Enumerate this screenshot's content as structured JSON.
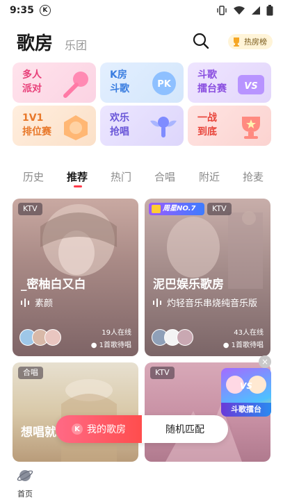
{
  "status_bar": {
    "time": "9:35",
    "badge": "K"
  },
  "header": {
    "title": "歌房",
    "subtitle": "乐团",
    "hot_label": "热房榜"
  },
  "categories": [
    {
      "label": "多人\n派对"
    },
    {
      "label": "K房\n斗歌"
    },
    {
      "label": "斗歌\n擂台赛"
    },
    {
      "label": "1V1\n排位赛"
    },
    {
      "label": "欢乐\n抢唱"
    },
    {
      "label": "一战\n到底"
    }
  ],
  "category_art_text": {
    "pk": "PK",
    "vs": "VS"
  },
  "tabs": [
    {
      "label": "历史"
    },
    {
      "label": "推荐"
    },
    {
      "label": "热门"
    },
    {
      "label": "合唱"
    },
    {
      "label": "附近"
    },
    {
      "label": "抢麦"
    }
  ],
  "rooms": [
    {
      "tag": "KTV",
      "name": "_密柚白又白",
      "song": "素颜",
      "online": "19人在线",
      "waiting": "1首歌待唱"
    },
    {
      "tag": "KTV",
      "name": "泥巴娱乐歌房",
      "song": "灼轻音乐串烧纯音乐版",
      "online": "43人在线",
      "waiting": "1首歌待唱",
      "promo": "周星NO.7"
    },
    {
      "tag": "合唱",
      "name": "想唱就唱"
    },
    {
      "tag": "KTV",
      "name": ""
    }
  ],
  "float_widget": {
    "label": "斗歌擂台",
    "close": "×"
  },
  "actions": {
    "mine_badge": "K",
    "mine": "我的歌房",
    "random": "随机匹配"
  },
  "bottom_nav": {
    "home": "首页"
  }
}
